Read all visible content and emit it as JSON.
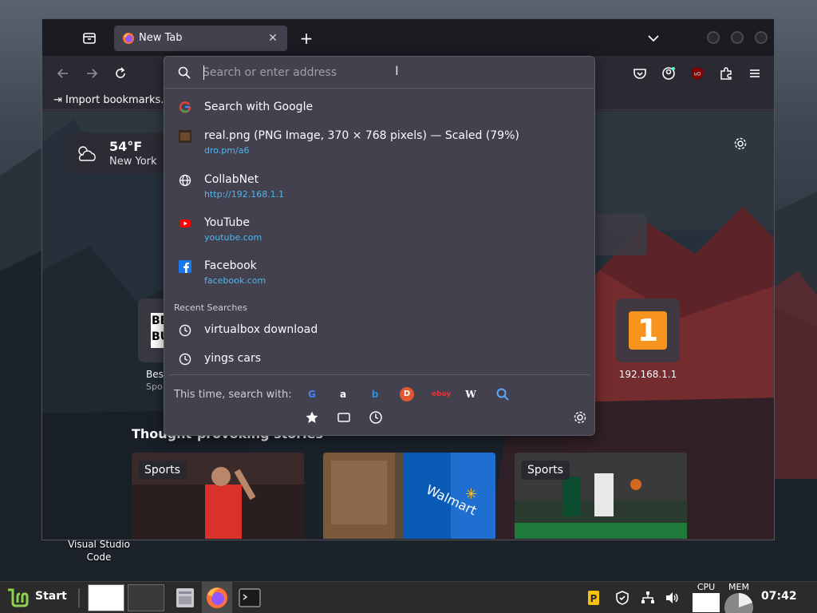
{
  "desktop": {
    "icon_label": "Visual Studio\nCode"
  },
  "browser": {
    "tab_title": "New Tab",
    "bookmarks_item": "Import bookmarks...",
    "weather": {
      "temp": "54°F",
      "city": "New York"
    },
    "top_sites": [
      {
        "label": "Bes",
        "sub": "Spo"
      },
      {
        "label": "192.168.1.1",
        "sub": ""
      }
    ],
    "stories_heading": "Thought-provoking stories",
    "stories": [
      {
        "tag": "Sports"
      },
      {
        "tag": ""
      },
      {
        "tag": "Sports"
      }
    ]
  },
  "urlbar": {
    "placeholder": "Search or enter address",
    "results": [
      {
        "icon": "google-icon",
        "title": "Search with Google",
        "url": ""
      },
      {
        "icon": "image-thumb-icon",
        "title": "real.png (PNG Image, 370 × 768 pixels) — Scaled (79%)",
        "url": "dro.pm/a6"
      },
      {
        "icon": "globe-icon",
        "title": "CollabNet",
        "url": "http://192.168.1.1"
      },
      {
        "icon": "youtube-icon",
        "title": "YouTube",
        "url": "youtube.com"
      },
      {
        "icon": "facebook-icon",
        "title": "Facebook",
        "url": "facebook.com"
      }
    ],
    "recent_label": "Recent Searches",
    "recent": [
      "virtualbox download",
      "yings cars"
    ],
    "oneoff_label": "This time, search with:",
    "engines": [
      "google",
      "amazon",
      "bing",
      "duckduckgo",
      "ebay",
      "wikipedia",
      "search"
    ],
    "modes": [
      "bookmarks",
      "tabs",
      "history"
    ]
  },
  "taskbar": {
    "start_label": "Start",
    "cpu_label": "CPU",
    "mem_label": "MEM",
    "clock": "07:42"
  },
  "colors": {
    "accent_link": "#4db6f2",
    "panel": "#42414d",
    "toolbar": "#2b2a33"
  }
}
